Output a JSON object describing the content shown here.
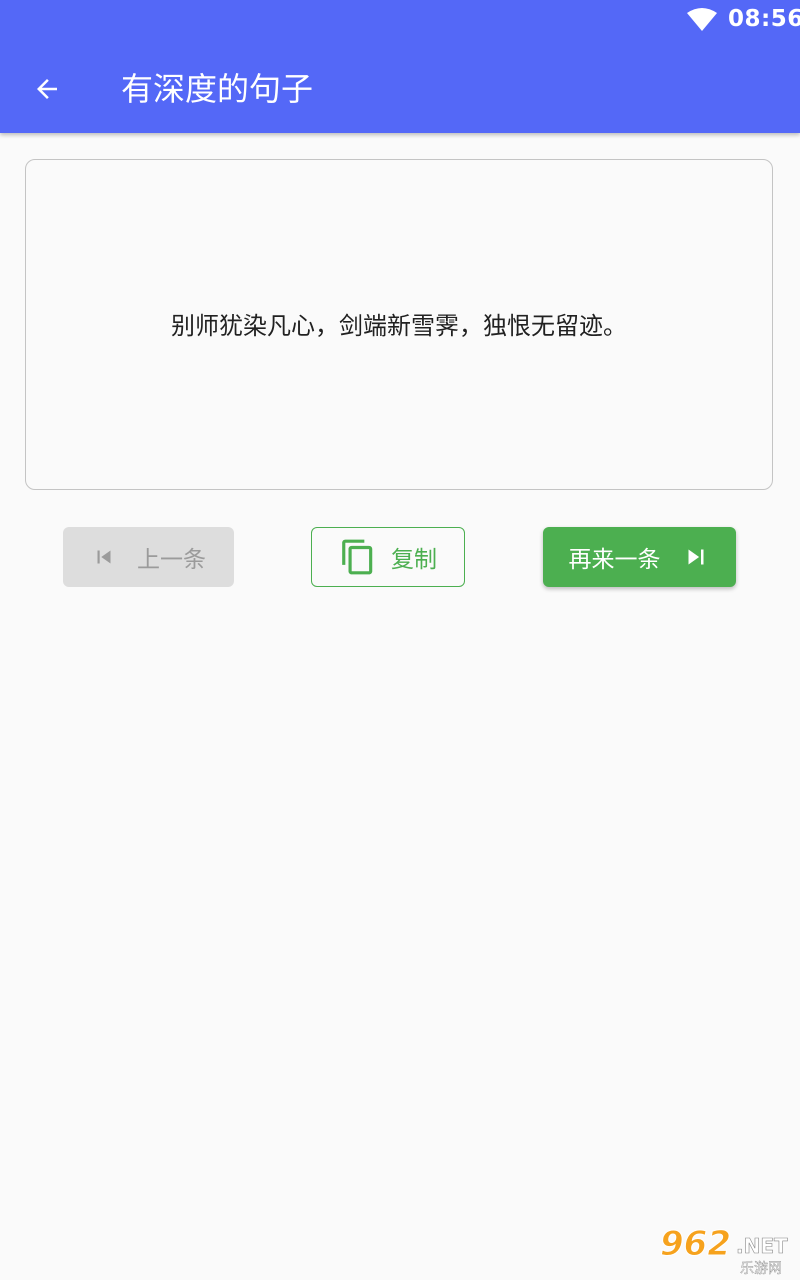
{
  "status_bar": {
    "time": "08:56",
    "wifi_icon": "wifi-icon"
  },
  "app_bar": {
    "title": "有深度的句子",
    "back_icon": "arrow-left-icon",
    "background_color": "#5468f7"
  },
  "quote": {
    "text": "别师犹染凡心，剑端新雪霁，独恨无留迹。"
  },
  "actions": {
    "prev": {
      "label": "上一条",
      "icon": "skip-previous-icon",
      "enabled": false
    },
    "copy": {
      "label": "复制",
      "icon": "copy-icon"
    },
    "next": {
      "label": "再来一条",
      "icon": "skip-next-icon"
    },
    "accent_color": "#4caf50"
  },
  "watermark": {
    "main": "962",
    "suffix": ".NET",
    "subtitle": "乐游网"
  }
}
